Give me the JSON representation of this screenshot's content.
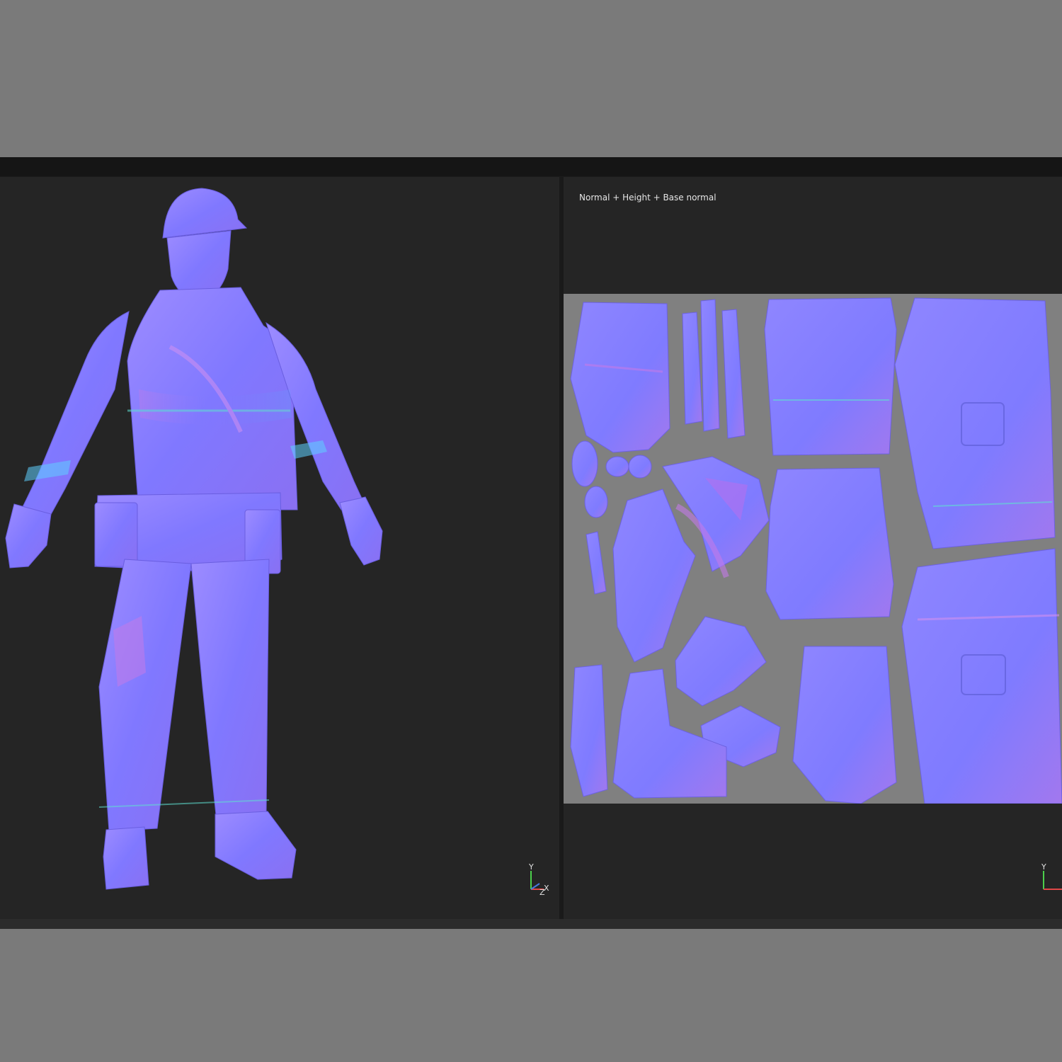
{
  "texture_viewer": {
    "channel_label": "Normal + Height + Base normal"
  },
  "axis_gizmo_3d": {
    "y_label": "Y",
    "z_label": "Z",
    "x_label": "X"
  },
  "axis_gizmo_2d": {
    "y_label": "Y"
  },
  "colors": {
    "normal_map_base": "#8080ff",
    "normal_map_violet": "#9a6ef0",
    "normal_map_magenta": "#c87ce6",
    "uv_background": "#808080",
    "viewport_background": "#252525",
    "outer_background": "#7a7a7a"
  },
  "icons": {
    "model_preview": "worker-model-normal-map",
    "uv_layout": "uv-island-texture"
  }
}
